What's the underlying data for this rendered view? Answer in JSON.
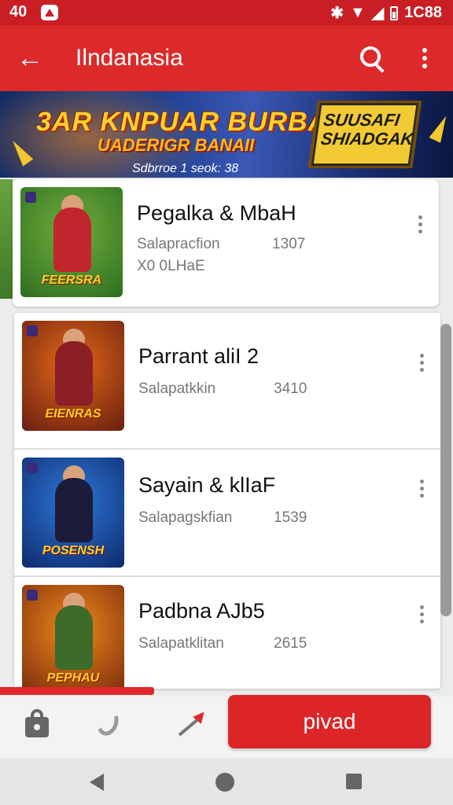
{
  "status_bar": {
    "time": "40",
    "right_text": "1C88",
    "icons": [
      "notification-icon",
      "bluetooth-icon",
      "wifi-icon",
      "signal-icon",
      "battery-icon"
    ]
  },
  "app_bar": {
    "back_icon": "arrow-left-icon",
    "title": "Ilndanasia",
    "search_icon": "search-icon",
    "more_icon": "more-vert-icon"
  },
  "banner": {
    "headline": "3AR KNPUAR BURBANI!",
    "subline": "UADERIGR BANAII",
    "date": "Sdbrroe 1 seok: 38",
    "badge": "SUUSAFI SHIADGAK"
  },
  "cards": [
    {
      "title": "Pegalka & MbaH",
      "subtitle": "Salapracfion",
      "count": "1307",
      "extra": "X0 0LHaE",
      "thumb_caption": "FEERSRA",
      "thumb_colors": [
        "#6fae3a",
        "#2f6e22"
      ],
      "fig_color": "#c0262c"
    },
    {
      "title": "Parrant aliI 2",
      "subtitle": "Salapatkkin",
      "count": "3410",
      "extra": "",
      "thumb_caption": "EIENRAS",
      "thumb_colors": [
        "#e46a18",
        "#6a1e10"
      ],
      "fig_color": "#8c1f26"
    },
    {
      "title": "Sayain & klIaF",
      "subtitle": "Salapagskfian",
      "count": "1539",
      "extra": "",
      "thumb_caption": "POSENSH",
      "thumb_colors": [
        "#2d78d8",
        "#0f2a6e"
      ],
      "fig_color": "#1c1c3a"
    },
    {
      "title": "Padbna AJb5",
      "subtitle": "Salapatklitan",
      "count": "2615",
      "extra": "",
      "thumb_caption": "PEPHAU",
      "thumb_colors": [
        "#f08a1c",
        "#7a2a0c"
      ],
      "fig_color": "#3d6b2a"
    }
  ],
  "progress": {
    "value": 0.34
  },
  "bottom_bar": {
    "icons": [
      "bag-icon",
      "hook-icon",
      "pen-icon"
    ],
    "primary_label": "pivad"
  },
  "nav_bar": {
    "icons": [
      "nav-back-icon",
      "nav-home-icon",
      "nav-recent-icon"
    ]
  },
  "colors": {
    "accent": "#dc2a2a",
    "status_bar": "#c81e24",
    "button": "#dd2528"
  }
}
